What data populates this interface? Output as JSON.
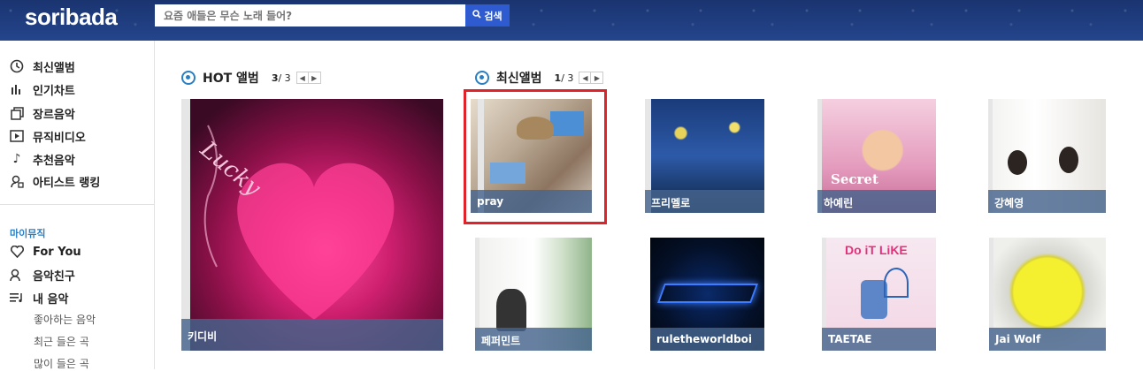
{
  "header": {
    "logo": "soribada",
    "search_placeholder": "요즘 애들은 무슨 노래 들어?",
    "search_button": "검색"
  },
  "sidebar": {
    "items": [
      {
        "label": "최신앨범",
        "icon": "new-album-icon"
      },
      {
        "label": "인기차트",
        "icon": "chart-icon"
      },
      {
        "label": "장르음악",
        "icon": "genre-icon"
      },
      {
        "label": "뮤직비디오",
        "icon": "video-icon"
      },
      {
        "label": "추천음악",
        "icon": "music-note-icon"
      },
      {
        "label": "아티스트 랭킹",
        "icon": "artist-icon"
      }
    ],
    "my_music_title": "마이뮤직",
    "my_items": [
      {
        "label": "For You",
        "icon": "heart-icon"
      },
      {
        "label": "음악친구",
        "icon": "friends-icon"
      },
      {
        "label": "내 음악",
        "icon": "playlist-icon"
      }
    ],
    "sub_items": [
      "좋아하는 음악",
      "최근 들은 곡",
      "많이 들은 곡"
    ]
  },
  "hot": {
    "title": "HOT 앨범",
    "page_current": "3",
    "page_total": "/ 3",
    "album": {
      "label": "키디비"
    }
  },
  "new": {
    "title": "최신앨범",
    "page_current": "1",
    "page_total": "/ 3",
    "albums": [
      {
        "label": "pray"
      },
      {
        "label": "프리멜로"
      },
      {
        "label": "하예린"
      },
      {
        "label": "강혜영"
      },
      {
        "label": "페퍼민트"
      },
      {
        "label": "ruletheworldboi"
      },
      {
        "label": "TAETAE"
      },
      {
        "label": "Jai Wolf"
      }
    ]
  },
  "colors": {
    "header": "#1d3a78",
    "accent_blue": "#2a7fc2",
    "highlight_red": "#e0222a"
  }
}
